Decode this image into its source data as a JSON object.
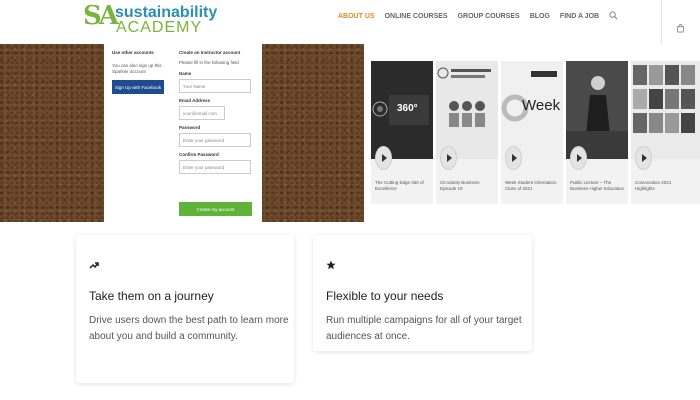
{
  "header": {
    "logo_mark": "SA",
    "logo_line1": "sustainability",
    "logo_line2": "ACADEMY",
    "nav": [
      "ABOUT US",
      "ONLINE COURSES",
      "GROUP COURSES",
      "BLOG",
      "FIND A JOB"
    ],
    "active_nav": "ABOUT US",
    "icons": [
      "search-icon",
      "cart-icon"
    ]
  },
  "signup": {
    "left_heading": "Use other accounts",
    "left_text": "You can also sign up this Sparkier account",
    "facebook_button": "Sign Up with Facebook",
    "right_heading": "Create an Instructor account",
    "right_text": "Please fill in the following field",
    "fields": [
      {
        "label": "Name",
        "placeholder": "Your Name"
      },
      {
        "label": "Email Address",
        "placeholder": "your@email.com"
      },
      {
        "label": "Password",
        "placeholder": "Enter your password"
      },
      {
        "label": "Confirm Password",
        "placeholder": "Enter your password"
      }
    ],
    "create_button": "Create my account"
  },
  "videos": [
    {
      "title": "The Cutting Edge 360 of Excellence",
      "thumb_text": "360°"
    },
    {
      "title": "Circularity Business Episode 19",
      "thumb_text": ""
    },
    {
      "title": "Week Student Orientation Class of 2021",
      "thumb_text": "Week"
    },
    {
      "title": "Public Lecture – The Business Higher Education",
      "thumb_text": ""
    },
    {
      "title": "Convocation 2021 Highlights",
      "thumb_text": ""
    }
  ],
  "features": [
    {
      "icon": "trend-arrow-icon",
      "title": "Take them on a journey",
      "text": "Drive users down the best path to learn more about you and build a community."
    },
    {
      "icon": "star-icon",
      "title": "Flexible to your needs",
      "text": "Run multiple campaigns for all of your target audiences at once."
    }
  ],
  "colors": {
    "accent": "#e08a1e",
    "brand_blue": "#2a8fb3",
    "brand_green": "#7bb43a",
    "facebook": "#1f4c8f",
    "create": "#5fb33b"
  }
}
